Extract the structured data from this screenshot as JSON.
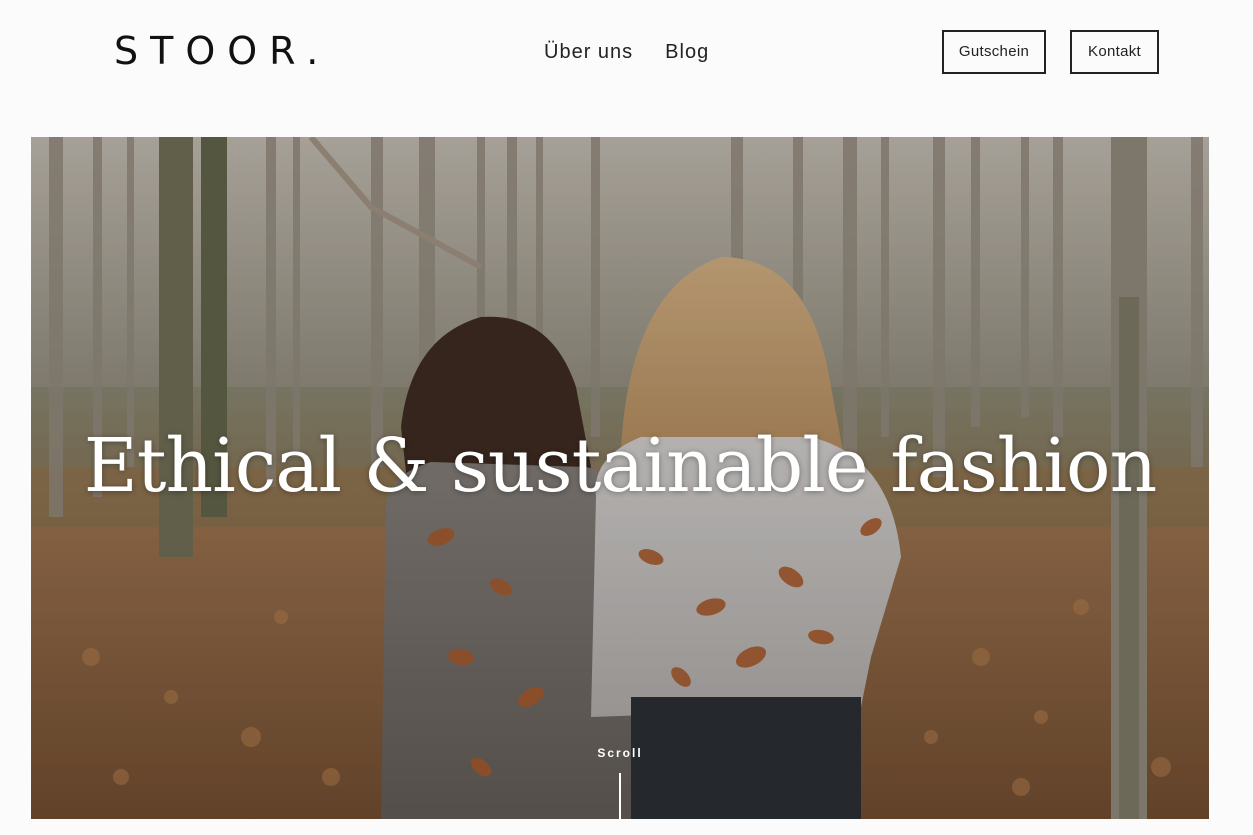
{
  "header": {
    "logo": "STOOR.",
    "nav": [
      "Über uns",
      "Blog"
    ],
    "gift_button": "Gutschein",
    "contact_button": "Kontakt"
  },
  "hero": {
    "headline": "Ethical & sustainable fashion",
    "scroll_label": "Scroll",
    "image_subject": "two women in knit sweaters covered with autumn leaves, seen from behind in a forest"
  },
  "colors": {
    "background": "#fbfbfb",
    "text": "#111111",
    "hero_text": "#ffffff",
    "border": "#222222"
  }
}
